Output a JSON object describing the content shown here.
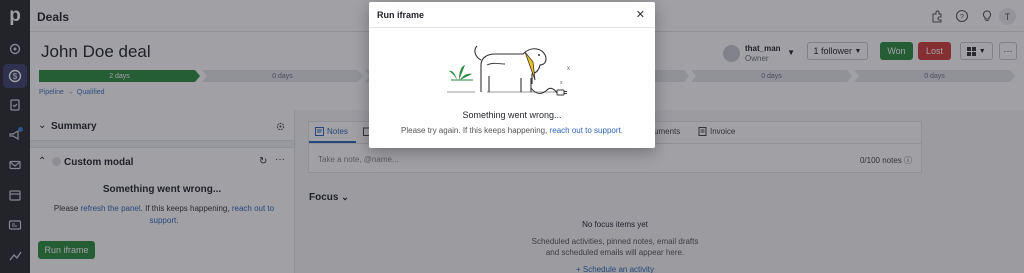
{
  "app": {
    "page_title": "Deals",
    "user_initial": "T"
  },
  "deal": {
    "title": "John Doe deal",
    "owner_name": "that_man",
    "owner_role": "Owner",
    "follower_label": "1 follower",
    "won_label": "Won",
    "lost_label": "Lost",
    "pipeline_stages": [
      {
        "label": "2 days",
        "done": true
      },
      {
        "label": "0 days",
        "done": false
      },
      {
        "label": "0 days",
        "done": false
      },
      {
        "label": "0 days",
        "done": false
      },
      {
        "label": "0 days",
        "done": false
      },
      {
        "label": "0 days",
        "done": false
      }
    ],
    "breadcrumb": {
      "pipeline": "Pipeline",
      "stage": "Qualified"
    }
  },
  "left_panel": {
    "summary_label": "Summary",
    "custom_modal_label": "Custom modal",
    "error_title": "Something went wrong...",
    "error_prefix": "Please",
    "error_refresh_link": "refresh the panel",
    "error_middle": ". If this keeps happening,",
    "error_support_link": "reach out to support",
    "error_suffix": ".",
    "run_button": "Run iframe"
  },
  "right_panel": {
    "tabs": [
      "Notes",
      "",
      "",
      "",
      "",
      "",
      "cuments",
      "Invoice"
    ],
    "note_placeholder": "Take a note, @name...",
    "note_count": "0/100 notes",
    "focus_label": "Focus",
    "focus_empty": "No focus items yet",
    "focus_desc_1": "Scheduled activities, pinned notes, email drafts",
    "focus_desc_2": "and scheduled emails will appear here.",
    "focus_link": "+ Schedule an activity"
  },
  "modal": {
    "title": "Run iframe",
    "error_title": "Something went wrong...",
    "error_body_prefix": "Please try again. If this keeps happening,",
    "error_body_link": "reach out to support",
    "error_body_suffix": "."
  },
  "colors": {
    "sidebar": "#26292c",
    "won": "#2a8a3e",
    "lost": "#d13b3b",
    "link": "#2e64b7"
  }
}
